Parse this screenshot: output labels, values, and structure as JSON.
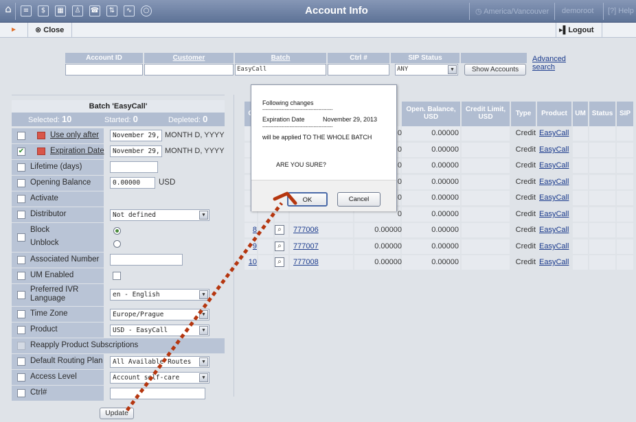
{
  "topbar": {
    "title": "Account Info",
    "timezone": "America/Vancouver",
    "user": "demoroot",
    "help": "Help",
    "icons": [
      "home-icon",
      "list-icon",
      "dollar-icon",
      "grid-icon",
      "person-icon",
      "phone-list-icon",
      "transfer-icon",
      "chart-icon",
      "search-icon"
    ]
  },
  "toolbar": {
    "close_label": "Close",
    "logout_label": "Logout"
  },
  "search": {
    "headers": [
      "Account ID",
      "Customer",
      "Batch",
      "Ctrl #",
      "SIP Status"
    ],
    "batch_value": "EasyCall",
    "sip_status_value": "ANY",
    "show_accounts_label": "Show Accounts",
    "advanced_label": "Advanced",
    "search_label": "search"
  },
  "batch_panel": {
    "title": "Batch 'EasyCall'",
    "selected_label": "Selected:",
    "selected_value": "10",
    "started_label": "Started:",
    "started_value": "0",
    "depleted_label": "Depleted:",
    "depleted_value": "0",
    "use_only_after_label": "Use only after",
    "use_only_after_value": "November 29, 2013",
    "use_only_after_hint": "MONTH D, YYYY",
    "expiration_label": "Expiration Date",
    "expiration_value": "November 29, 2013",
    "expiration_hint": "MONTH D, YYYY",
    "lifetime_label": "Lifetime (days)",
    "opening_balance_label": "Opening Balance",
    "opening_balance_value": "0.00000",
    "opening_balance_currency": "USD",
    "activate_label": "Activate",
    "distributor_label": "Distributor",
    "distributor_value": "Not defined",
    "block_label": "Block",
    "unblock_label": "Unblock",
    "associated_number_label": "Associated Number",
    "um_enabled_label": "UM Enabled",
    "ivr_language_label_1": "Preferred IVR",
    "ivr_language_label_2": "Language",
    "ivr_language_value": "en - English",
    "time_zone_label": "Time Zone",
    "time_zone_value": "Europe/Prague",
    "product_label": "Product",
    "product_value": "USD - EasyCall",
    "reapply_label": "Reapply Product Subscriptions",
    "routing_label": "Default Routing Plan",
    "routing_value": "All Available Routes",
    "access_label": "Access Level",
    "access_value": "Account self-care",
    "ctrl_label": "Ctrl#",
    "update_label": "Update"
  },
  "table": {
    "headers": {
      "c": "C",
      "opening_balance": "Open. Balance, USD",
      "credit_limit": "Credit Limit, USD",
      "type": "Type",
      "product": "Product",
      "um": "UM",
      "status": "Status",
      "sip": "SIP"
    },
    "rows": [
      {
        "num": "",
        "id": "",
        "balance": "0",
        "open_balance": "0.00000",
        "type": "Credit",
        "product": "EasyCall"
      },
      {
        "num": "",
        "id": "",
        "balance": "0",
        "open_balance": "0.00000",
        "type": "Credit",
        "product": "EasyCall"
      },
      {
        "num": "",
        "id": "",
        "balance": "0",
        "open_balance": "0.00000",
        "type": "Credit",
        "product": "EasyCall"
      },
      {
        "num": "",
        "id": "",
        "balance": "0",
        "open_balance": "0.00000",
        "type": "Credit",
        "product": "EasyCall"
      },
      {
        "num": "",
        "id": "",
        "balance": "0",
        "open_balance": "0.00000",
        "type": "Credit",
        "product": "EasyCall"
      },
      {
        "num": "",
        "id": "",
        "balance": "0",
        "open_balance": "0.00000",
        "type": "Credit",
        "product": "EasyCall"
      },
      {
        "num": "8",
        "id": "777006",
        "balance": "0.00000",
        "open_balance": "0.00000",
        "type": "Credit",
        "product": "EasyCall"
      },
      {
        "num": "9",
        "id": "777007",
        "balance": "0.00000",
        "open_balance": "0.00000",
        "type": "Credit",
        "product": "EasyCall"
      },
      {
        "num": "10",
        "id": "777008",
        "balance": "0.00000",
        "open_balance": "0.00000",
        "type": "Credit",
        "product": "EasyCall"
      }
    ]
  },
  "dialog": {
    "line1": "Following changes",
    "dashes": "--------------------------------------------",
    "change_field": "Expiration Date",
    "change_value": "November 29, 2013",
    "line_batch": "will be applied TO THE WHOLE BATCH",
    "question": "ARE YOU SURE?",
    "ok_label": "OK",
    "cancel_label": "Cancel"
  },
  "annotation_color": "#b5360f"
}
